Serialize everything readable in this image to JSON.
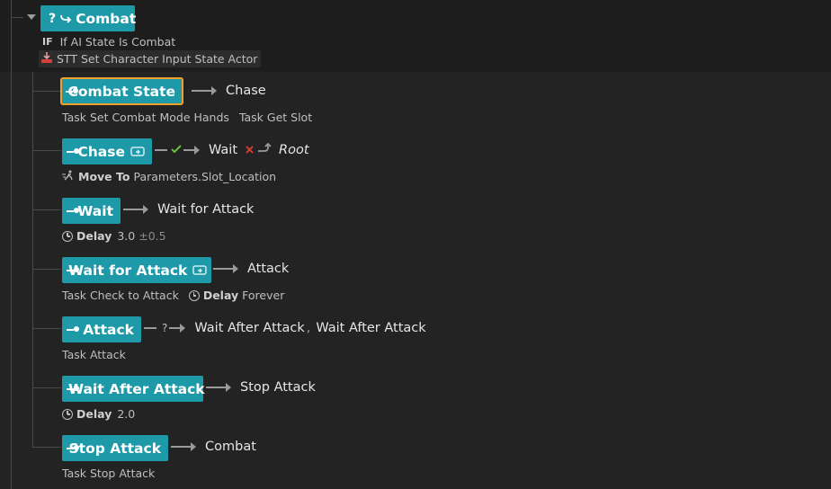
{
  "parent_state": {
    "name": "Combat",
    "prefix_glyph": "?",
    "condition_tag": "IF",
    "condition_text": "If AI State Is Combat",
    "task_text": "STT Set Character Input State Actor"
  },
  "states": [
    {
      "name": "Combat State",
      "selected": true,
      "transitions": [
        {
          "target": "Chase"
        }
      ],
      "tasks": [
        "Task Set Combat Mode Hands",
        "Task Get Slot"
      ]
    },
    {
      "name": "Chase",
      "linked": true,
      "transition_success": "Wait",
      "transition_fail": "Root",
      "task_bold": "Move To",
      "task_param": "Parameters.Slot_Location"
    },
    {
      "name": "Wait",
      "transitions": [
        {
          "target": "Wait for Attack"
        }
      ],
      "delay_label": "Delay",
      "delay_value": "3.0",
      "delay_variance": "±0.5"
    },
    {
      "name": "Wait for Attack",
      "linked": true,
      "transitions": [
        {
          "target": "Attack"
        }
      ],
      "task_text": "Task Check to Attack",
      "delay_label": "Delay",
      "delay_value": "Forever"
    },
    {
      "name": "Attack",
      "transition_glyph": "?",
      "transitions": [
        {
          "target": "Wait After Attack"
        },
        {
          "target": "Wait After Attack"
        }
      ],
      "tasks": [
        "Task Attack"
      ]
    },
    {
      "name": "Wait After Attack",
      "transitions": [
        {
          "target": "Stop Attack"
        }
      ],
      "delay_label": "Delay",
      "delay_value": "2.0"
    },
    {
      "name": "Stop Attack",
      "transitions": [
        {
          "target": "Combat"
        }
      ],
      "tasks": [
        "Task Stop Attack"
      ]
    }
  ],
  "colors": {
    "node": "#1e99a8",
    "selected_outline": "#f1a02b",
    "success": "#6fbf3a",
    "fail": "#d9403a",
    "background": "#1a1a1a"
  },
  "icons": [
    "chevron-down-icon",
    "enter-state-icon",
    "linked-subtree-icon",
    "clock-icon",
    "move-to-icon",
    "checkmark-icon",
    "cross-icon",
    "task-actor-icon"
  ]
}
